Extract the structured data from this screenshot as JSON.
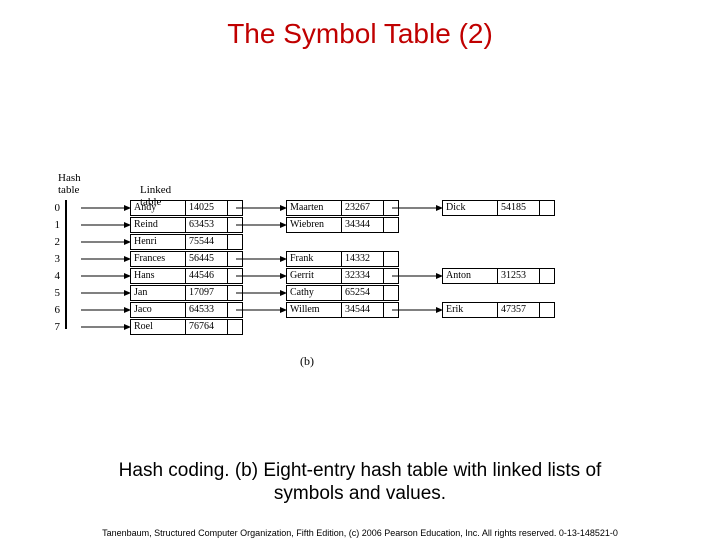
{
  "title": "The Symbol Table (2)",
  "caption_line1": "Hash coding.  (b) Eight-entry hash table with linked lists of",
  "caption_line2": "symbols and values.",
  "footer": "Tanenbaum, Structured Computer Organization, Fifth Edition, (c) 2006 Pearson Education, Inc. All rights reserved. 0-13-148521-0",
  "headers": {
    "hash": "Hash\ntable",
    "linked": "Linked table"
  },
  "hash_count": 8,
  "figure_label": "(b)",
  "chart_data": {
    "type": "table",
    "title": "Eight-entry hash table with linked lists",
    "hash_table_size": 8,
    "buckets": [
      {
        "index": 0,
        "chain": [
          {
            "name": "Andy",
            "value": 14025
          },
          {
            "name": "Maarten",
            "value": 23267
          },
          {
            "name": "Dick",
            "value": 54185
          }
        ]
      },
      {
        "index": 1,
        "chain": [
          {
            "name": "Reind",
            "value": 63453
          },
          {
            "name": "Wiebren",
            "value": 34344
          }
        ]
      },
      {
        "index": 2,
        "chain": [
          {
            "name": "Henri",
            "value": 75544
          }
        ]
      },
      {
        "index": 3,
        "chain": [
          {
            "name": "Frances",
            "value": 56445
          },
          {
            "name": "Frank",
            "value": 14332
          }
        ]
      },
      {
        "index": 4,
        "chain": [
          {
            "name": "Hans",
            "value": 44546
          },
          {
            "name": "Gerrit",
            "value": 32334
          },
          {
            "name": "Anton",
            "value": 31253
          }
        ]
      },
      {
        "index": 5,
        "chain": [
          {
            "name": "Jan",
            "value": 17097
          },
          {
            "name": "Cathy",
            "value": 65254
          }
        ]
      },
      {
        "index": 6,
        "chain": [
          {
            "name": "Jaco",
            "value": 64533
          },
          {
            "name": "Willem",
            "value": 34544
          },
          {
            "name": "Erik",
            "value": 47357
          }
        ]
      },
      {
        "index": 7,
        "chain": [
          {
            "name": "Roel",
            "value": 76764
          }
        ]
      }
    ]
  }
}
